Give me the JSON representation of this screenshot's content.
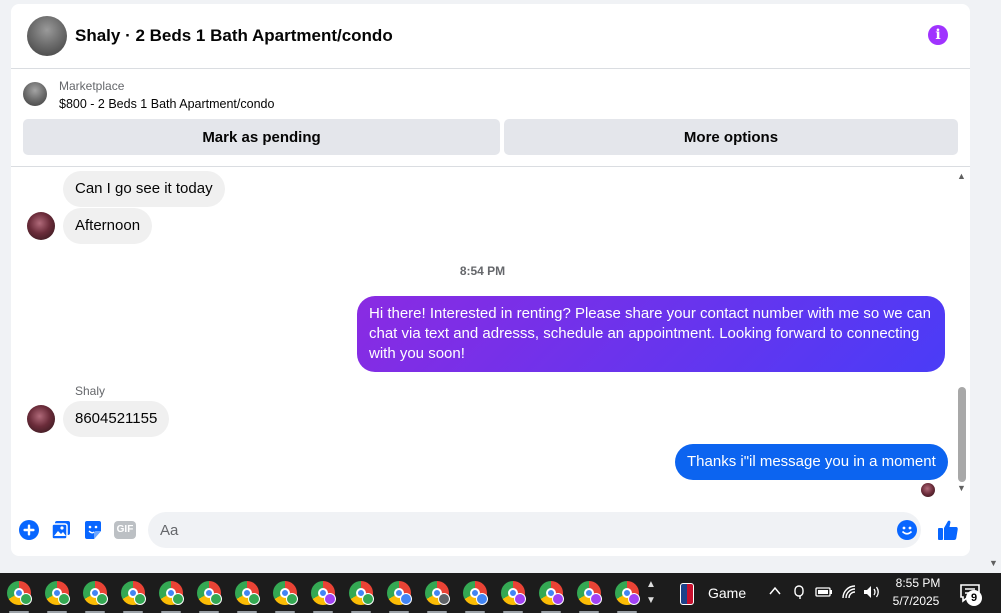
{
  "colors": {
    "accent_blue": "#0866ff",
    "info_purple": "#a033ff",
    "outgoing_gradient_purple": "#8a2be2",
    "outgoing_gradient_blue": "#4a3cf7",
    "outgoing_blue": "#0c64f0",
    "incoming_bubble": "#f0f0f0",
    "button_gray": "#e4e6eb",
    "taskbar": "#1c1c1c"
  },
  "header": {
    "title": "Shaly · 2 Beds 1 Bath Apartment/condo",
    "info_icon": "info-icon"
  },
  "listing": {
    "source": "Marketplace",
    "title": "$800 - 2 Beds 1 Bath Apartment/condo",
    "mark_pending_label": "Mark as pending",
    "more_options_label": "More options"
  },
  "messages": {
    "incoming_1": "Can I go see it today",
    "incoming_2": "Afternoon",
    "timestamp": "8:54 PM",
    "outgoing_1": "Hi there! Interested in renting? Please share your contact number with me so we can chat via text and adresss, schedule an appointment. Looking forward to connecting with you soon!",
    "sender_name": "Shaly",
    "incoming_3": "8604521155",
    "outgoing_2": "Thanks i\"il message you in a moment"
  },
  "composer": {
    "placeholder": "Aa",
    "icons": [
      "plus-icon",
      "photo-icon",
      "sticker-icon",
      "gif-icon",
      "emoji-icon",
      "like-icon"
    ],
    "gif_label": "GIF"
  },
  "taskbar": {
    "app_badge_colors": [
      "#34a853",
      "#34a853",
      "#34a853",
      "#34a853",
      "#34a853",
      "#34a853",
      "#34a853",
      "#34a853",
      "#a142f4",
      "#34a853",
      "#4285f4",
      "#5f6368",
      "#4285f4",
      "#a142f4",
      "#a142f4",
      "#a142f4",
      "#a142f4"
    ],
    "game_label": "Game",
    "time": "8:55 PM",
    "date": "5/7/2025",
    "notification_count": "9"
  }
}
